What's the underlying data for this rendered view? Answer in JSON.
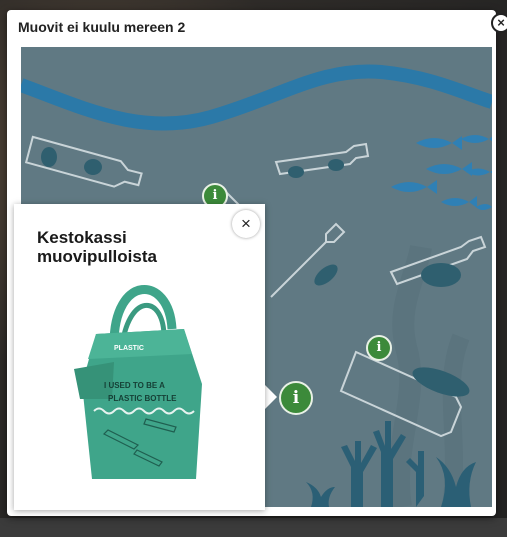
{
  "modal": {
    "title": "Muovit ei kuulu mereen 2",
    "close_label": "×"
  },
  "popup": {
    "title": "Kestokassi muovipulloista",
    "close_label": "×",
    "bag_text_1": "PLASTIC",
    "bag_text_2": "I USED TO BE A",
    "bag_text_3": "PLASTIC BOTTLE"
  },
  "hotspots": [
    {
      "label": "i",
      "icon": "info-icon"
    },
    {
      "label": "i",
      "icon": "info-icon"
    },
    {
      "label": "i",
      "icon": "info-icon"
    }
  ],
  "colors": {
    "scene_bg": "#627c84",
    "wave": "#2a77a6",
    "fish": "#2f7fb4",
    "bottle_stroke": "#c7d2d6",
    "hotspot": "#3c8a3a",
    "bag": "#3fa58a"
  }
}
